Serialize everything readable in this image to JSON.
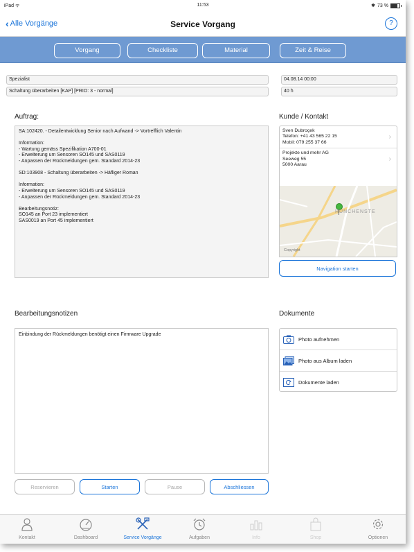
{
  "status_bar": {
    "carrier": "iPad ᯤ",
    "time": "11:53",
    "battery": "73 %"
  },
  "navbar": {
    "back_label": "Alle Vorgänge",
    "title": "Service Vorgang",
    "help": "?"
  },
  "tabs": [
    {
      "label": "Vorgang"
    },
    {
      "label": "Checkliste"
    },
    {
      "label": "Material"
    },
    {
      "label": "Zeit & Reise"
    }
  ],
  "header_fields": {
    "role": "Spezialist",
    "task": "Schaltung überarbeiten [KAP] [PRIO: 3 - normal]",
    "datetime": "04.08.14 00:00",
    "duration": "40 h"
  },
  "auftrag": {
    "label": "Auftrag:",
    "lines": [
      "SA:102420. - Detailentwicklung Senior nach Aufwand -> Vortrefflich Valentin",
      "",
      "Information:",
      "- Wartung gemäss Spezifikation A700-01",
      "- Erweiterung um Sensoren SO145 und SAS0119",
      "- Anpassen der Rückmeldungen gem. Standard 2014-23",
      "",
      "SD:103908 - Schaltung überarbeiten -> Häfliger Roman",
      "",
      "Information:",
      "- Erweiterung um Sensoren SO145 und SAS0119",
      "- Anpassen der Rückmeldungen gem. Standard 2014-23",
      "",
      "Bearbeitungsnotiz:",
      "SO145 an Port 23 implementiert",
      "SAS0019 an Port 45 implementiert"
    ]
  },
  "kunde": {
    "label": "Kunde / Kontakt",
    "contact_lines": [
      "Sven Dubroçek",
      "Telefon: +41 43 565 22 15",
      "Mobil: 079 255 37 66"
    ],
    "company_lines": [
      "Projekte und mehr AG",
      "Seeweg 55",
      "5000 Aarau"
    ],
    "map_place": "HUNCHENSTE",
    "map_copyright": "Copyright",
    "navigation_button": "Navigation starten"
  },
  "bearbeitungsnotizen": {
    "label": "Bearbeitungsnotizen",
    "text": "Einbindung der Rückmeldungen benötigt einen Firmware Upgrade"
  },
  "dokumente": {
    "label": "Dokumente",
    "items": [
      {
        "label": "Photo aufnehmen",
        "icon": "camera-icon"
      },
      {
        "label": "Photo aus Album laden",
        "icon": "photo-album-icon"
      },
      {
        "label": "Dokumente laden",
        "icon": "document-load-icon"
      }
    ]
  },
  "actions": {
    "reservieren": "Reservieren",
    "starten": "Starten",
    "pause": "Pause",
    "abschliessen": "Abschliessen"
  },
  "bottom_tabs": [
    {
      "label": "Kontakt",
      "icon": "person-icon",
      "state": "normal"
    },
    {
      "label": "Dashboard",
      "icon": "gauge-icon",
      "state": "normal"
    },
    {
      "label": "Service Vorgänge",
      "icon": "tools-icon",
      "state": "selected"
    },
    {
      "label": "Aufgaben",
      "icon": "alarm-clock-icon",
      "state": "normal"
    },
    {
      "label": "Info",
      "icon": "chart-icon",
      "state": "disabled"
    },
    {
      "label": "Shop",
      "icon": "shopping-bag-icon",
      "state": "disabled"
    },
    {
      "label": "Optionen",
      "icon": "gear-icon",
      "state": "normal"
    }
  ],
  "colors": {
    "accent": "#1a74d9",
    "tab_bar": "#6f9ad2",
    "panel_bg": "#f4f4f4"
  }
}
